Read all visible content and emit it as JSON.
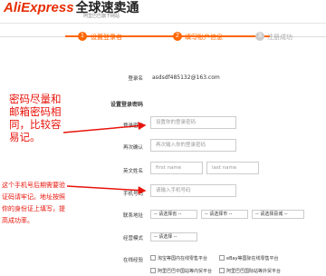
{
  "header": {
    "logo_en": "AliExpress",
    "logo_cn": "全球速卖通",
    "slogan": "阿里巴巴旗下网站"
  },
  "steps": [
    {
      "num": "1",
      "label": "设置登录名",
      "state": "done"
    },
    {
      "num": "2",
      "label": "填写账户信息",
      "state": "active"
    },
    {
      "num": "3",
      "label": "注册成功",
      "state": "todo"
    }
  ],
  "colors": {
    "accent": "#ff6600",
    "annotation": "#e8140b",
    "inactive": "#cccccc"
  },
  "form": {
    "login_label": "登录名",
    "login_value": "asdsdf485132@163.com",
    "section_title": "设置登录密码",
    "password_label": "登录密码",
    "password_placeholder": "设置你的登录密码",
    "confirm_label": "再次确认",
    "confirm_placeholder": "再次输入你的登录密码",
    "name_label": "英文姓名",
    "first_placeholder": "first name",
    "last_placeholder": "last name",
    "phone_label": "手机号码",
    "phone_placeholder": "请输入手机号码",
    "address_label": "联系地址",
    "province": "-- 请选择省 --",
    "city": "-- 请选择市 --",
    "county": "-- 请选择县城 --",
    "business_label": "经营模式",
    "business_select": "-- 请选择 --",
    "experience_label": "在线经验",
    "checkboxes": [
      "淘宝等国内在线零售平台",
      "eBay等国际在线零售平台",
      "阿里巴巴中国站等内贸平台",
      "阿里巴巴国际站等外贸平台"
    ]
  },
  "annotations": {
    "big_note": "密码尽量和邮箱密码相同，比较容易记。",
    "small_note": "这个手机号后期需要验证码请牢记。地址按照你的身份证上填写，提高成功率。"
  }
}
